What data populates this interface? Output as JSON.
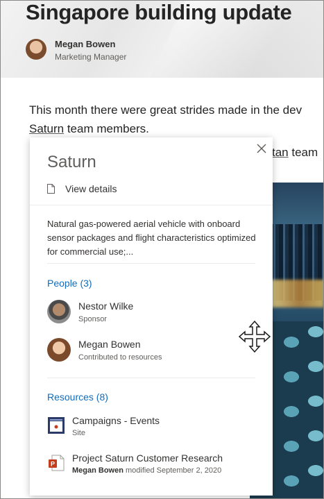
{
  "page": {
    "title": "Singapore building update",
    "author_name": "Megan Bowen",
    "author_role": "Marketing Manager",
    "body_line1": "This month there were great strides made in the dev",
    "body_line2_link": "Saturn",
    "body_line2_rest": " team members.",
    "body_hidden_link": "tan",
    "body_hidden_rest": " team"
  },
  "card": {
    "title": "Saturn",
    "view_details": "View details",
    "description": "Natural gas-powered aerial vehicle with onboard sensor packages and flight characteristics optimized for commercial use;...",
    "people_heading": "People (3)",
    "people": [
      {
        "name": "Nestor Wilke",
        "role": "Sponsor"
      },
      {
        "name": "Megan Bowen",
        "role": "Contributed to resources"
      }
    ],
    "resources_heading": "Resources (8)",
    "resources": [
      {
        "name": "Campaigns - Events",
        "sub": "Site"
      },
      {
        "name": "Project Saturn Customer Research",
        "sub_author": "Megan Bowen",
        "sub_rest": " modified September 2, 2020"
      }
    ]
  },
  "icons": {
    "close": "close-icon",
    "doc": "document-icon",
    "site": "site-icon",
    "powerpoint": "powerpoint-icon",
    "cursor": "move-cursor-icon"
  },
  "colors": {
    "link_blue": "#0f6cbd",
    "powerpoint_red": "#c43e1c",
    "site_navy": "#2b3a67"
  }
}
